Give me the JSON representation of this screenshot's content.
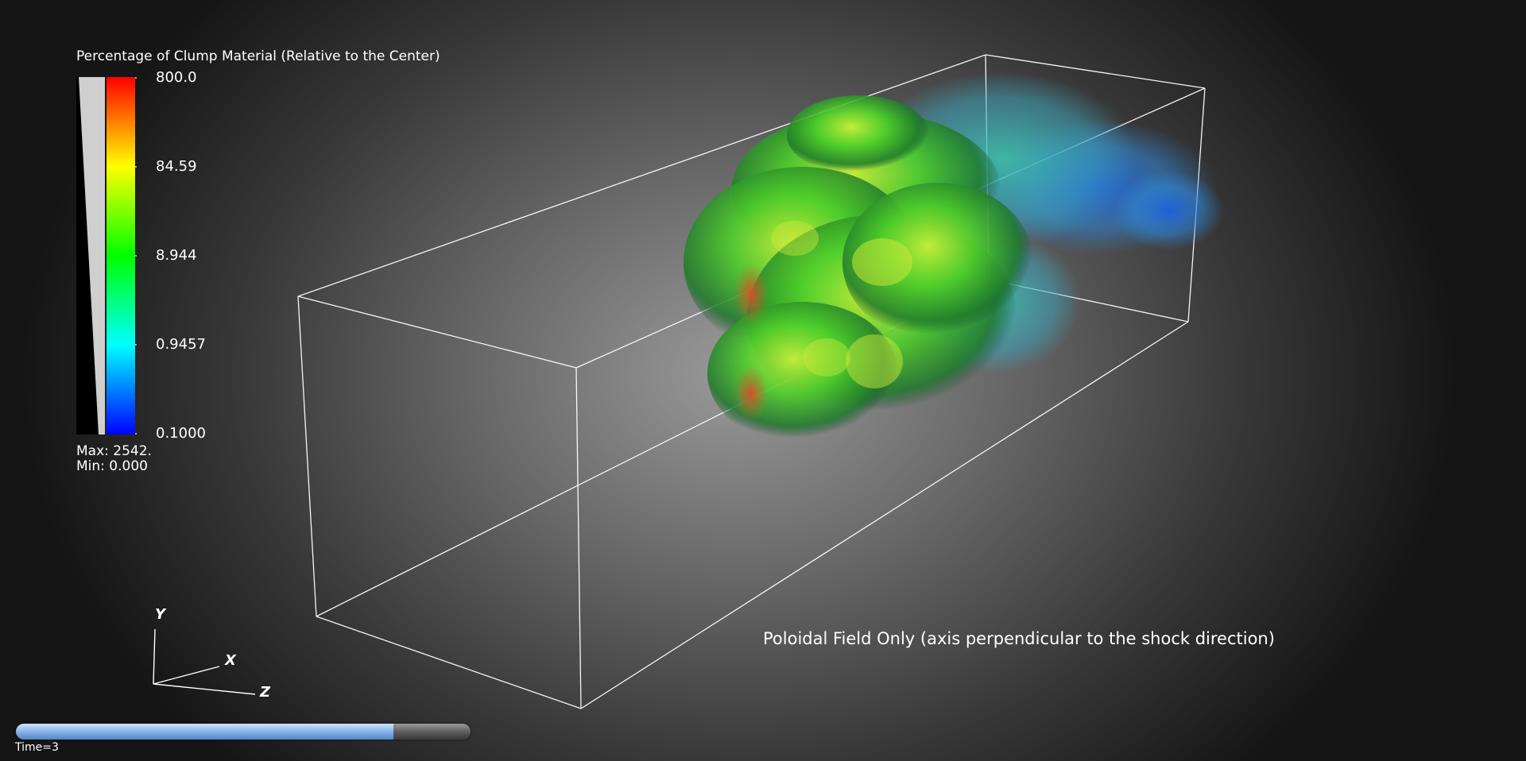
{
  "legend": {
    "title": "Percentage of Clump Material (Relative to the Center)",
    "ticks": [
      "800.0",
      "84.59",
      "8.944",
      "0.9457",
      "0.1000"
    ],
    "max_label": "Max:  2542.",
    "min_label": "Min:  0.000",
    "colormap": [
      "#0000ff",
      "#00ffff",
      "#00ff00",
      "#ffff00",
      "#ff0000"
    ]
  },
  "axes": {
    "x": "X",
    "y": "Y",
    "z": "Z"
  },
  "caption": "Poloidal Field Only (axis perpendicular to the shock direction)",
  "time": {
    "label": "Time=3",
    "progress": 0.83
  },
  "colors": {
    "box_outline": "#ffffff",
    "cloud_green": "#4fcf2a",
    "cloud_blue": "#2a7fd0",
    "cloud_red": "#d8502a",
    "slider_fill": "#8fb9ee"
  }
}
